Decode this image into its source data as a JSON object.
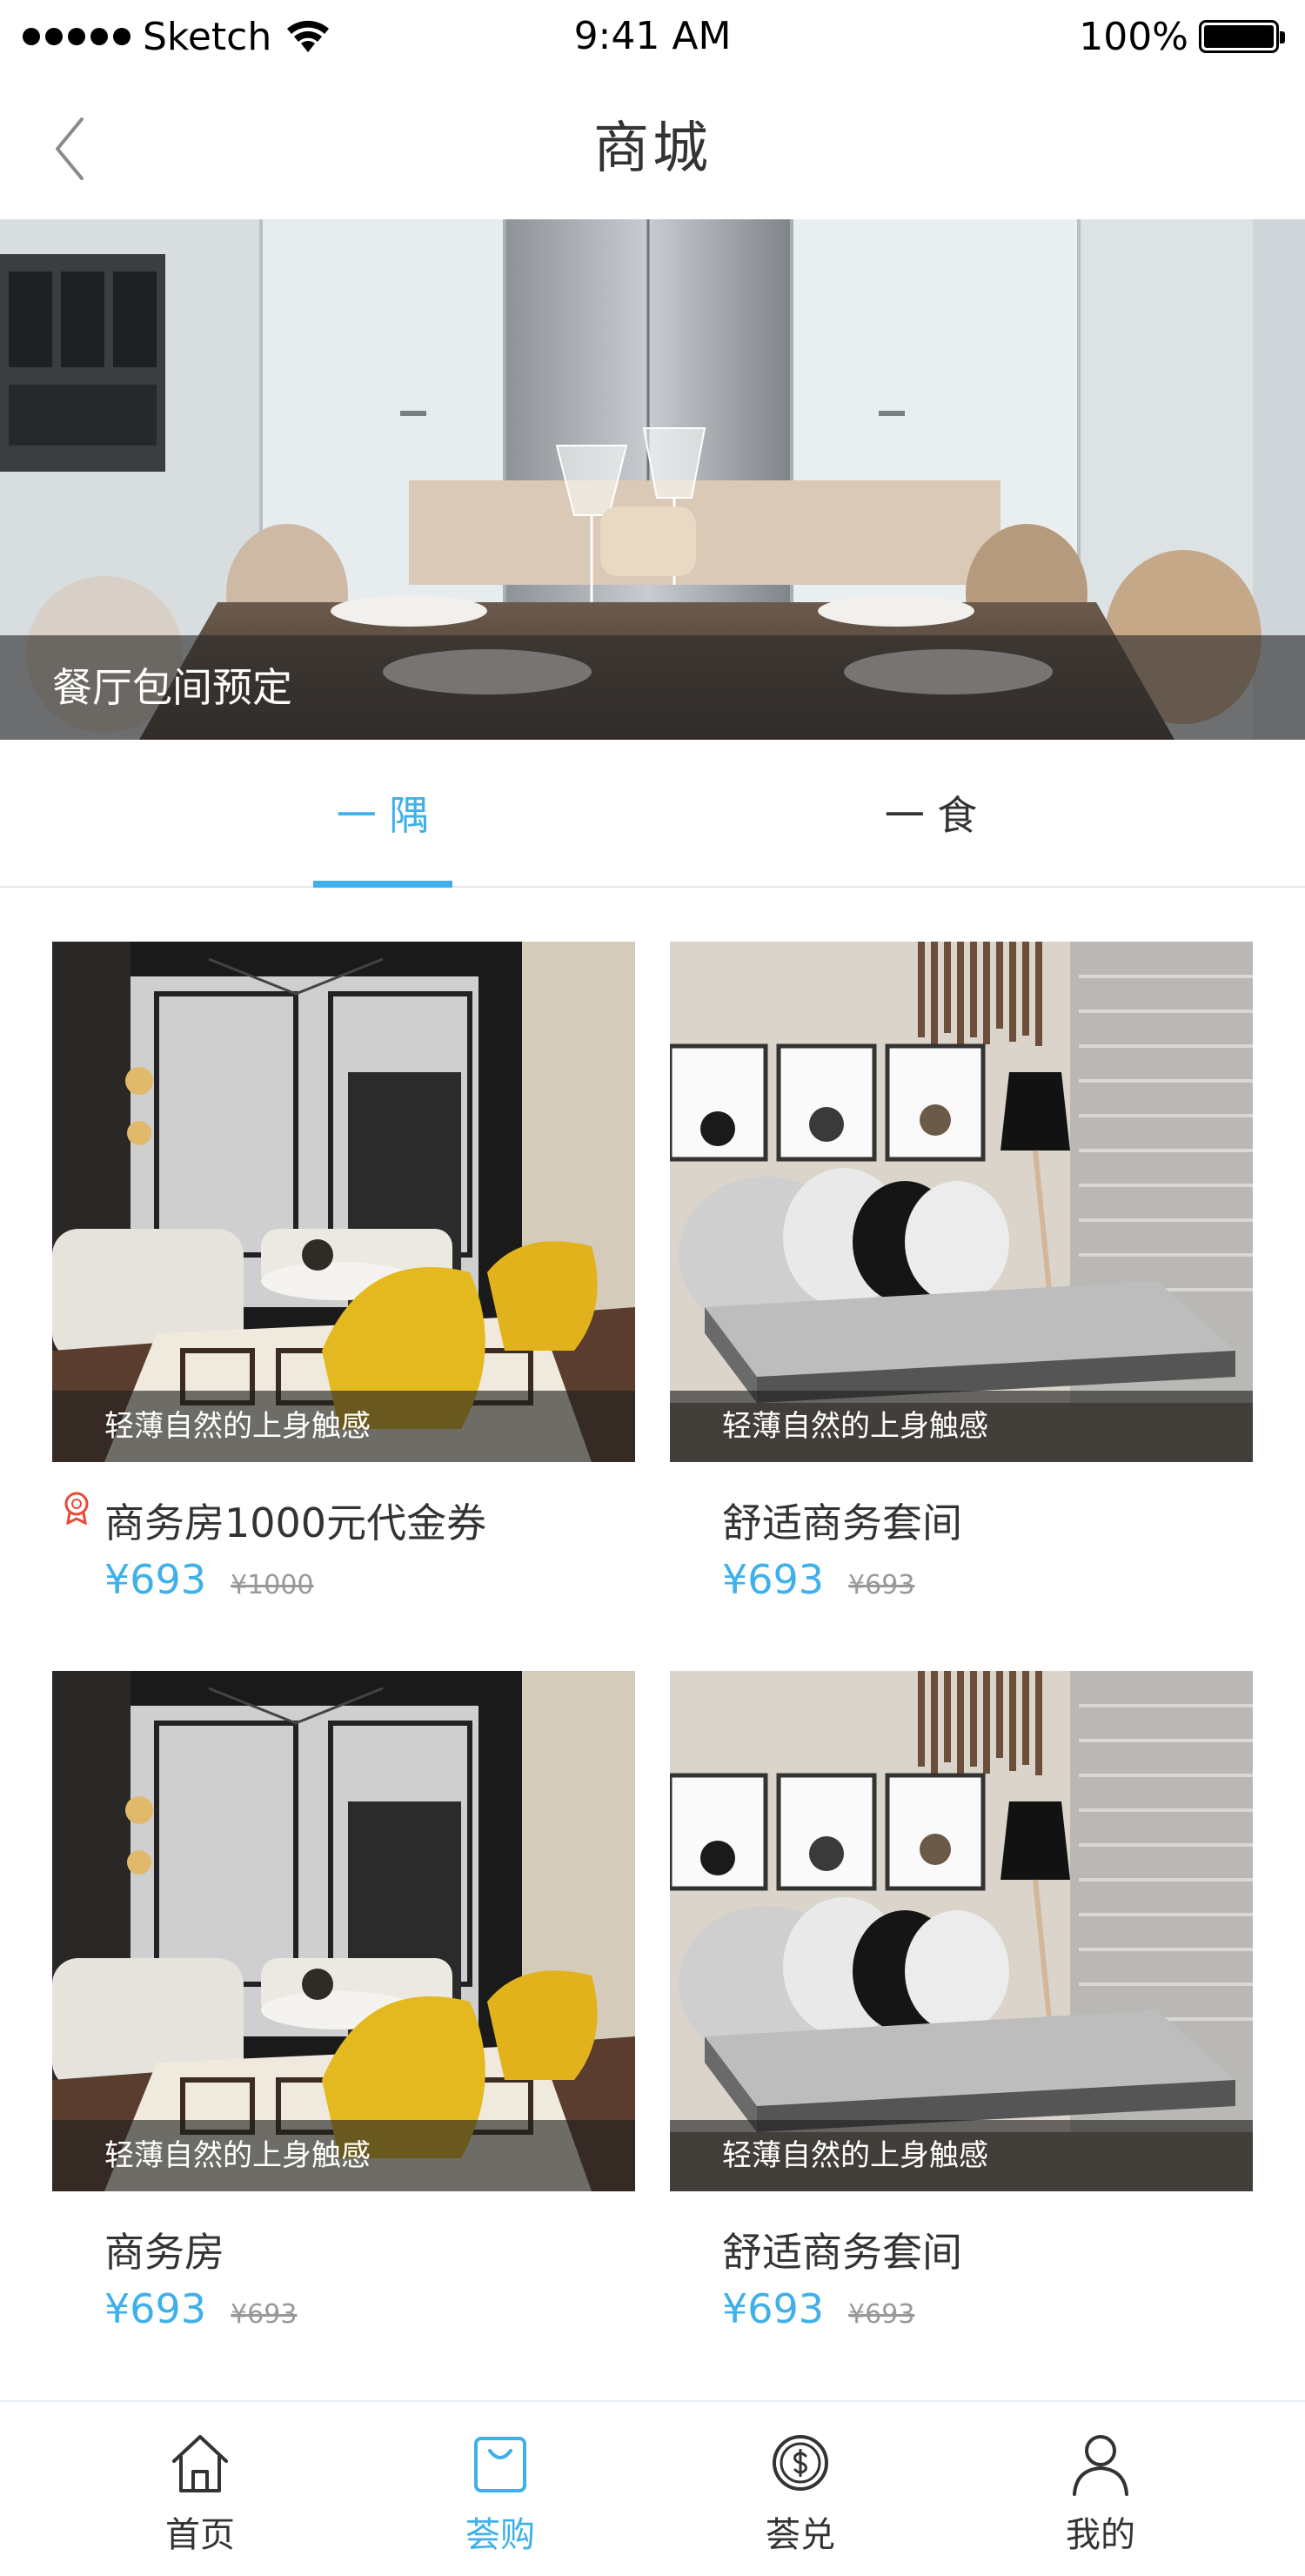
{
  "status_bar": {
    "carrier": "Sketch",
    "time": "9:41 AM",
    "battery": "100%"
  },
  "nav": {
    "title": "商城",
    "back_icon": "chevron-left-icon"
  },
  "banner": {
    "caption": "餐厅包间预定"
  },
  "tabs": [
    {
      "label": "一 隅",
      "active": true
    },
    {
      "label": "一 食",
      "active": false
    }
  ],
  "products": [
    {
      "caption": "轻薄自然的上身触感",
      "title": "商务房1000元代金券",
      "price": "¥693",
      "old_price": "¥1000",
      "has_coupon_icon": true
    },
    {
      "caption": "轻薄自然的上身触感",
      "title": "舒适商务套间",
      "price": "¥693",
      "old_price": "¥693",
      "has_coupon_icon": false
    },
    {
      "caption": "轻薄自然的上身触感",
      "title": "商务房",
      "price": "¥693",
      "old_price": "¥693",
      "has_coupon_icon": false
    },
    {
      "caption": "轻薄自然的上身触感",
      "title": "舒适商务套间",
      "price": "¥693",
      "old_price": "¥693",
      "has_coupon_icon": false
    }
  ],
  "tabbar": [
    {
      "label": "首页",
      "icon": "home-icon",
      "active": false
    },
    {
      "label": "荟购",
      "icon": "shopping-bag-icon",
      "active": true
    },
    {
      "label": "荟兑",
      "icon": "coin-icon",
      "active": false
    },
    {
      "label": "我的",
      "icon": "user-icon",
      "active": false
    }
  ],
  "colors": {
    "accent": "#3fb0e9",
    "text": "#333333",
    "muted": "#999999"
  }
}
